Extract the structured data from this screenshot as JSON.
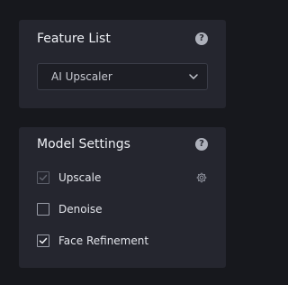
{
  "feature_list": {
    "title": "Feature List",
    "help_glyph": "?",
    "selected_feature": "AI Upscaler",
    "chevron_icon": "chevron-down-icon"
  },
  "model_settings": {
    "title": "Model Settings",
    "help_glyph": "?",
    "options": [
      {
        "label": "Upscale",
        "checked": true,
        "disabled": true,
        "has_settings": true
      },
      {
        "label": "Denoise",
        "checked": false,
        "disabled": false,
        "has_settings": false
      },
      {
        "label": "Face Refinement",
        "checked": true,
        "disabled": false,
        "has_settings": false
      }
    ]
  },
  "colors": {
    "background": "#17181d",
    "card": "#25262f",
    "text": "#eef0f5",
    "muted_icon": "#aeb1bb"
  }
}
